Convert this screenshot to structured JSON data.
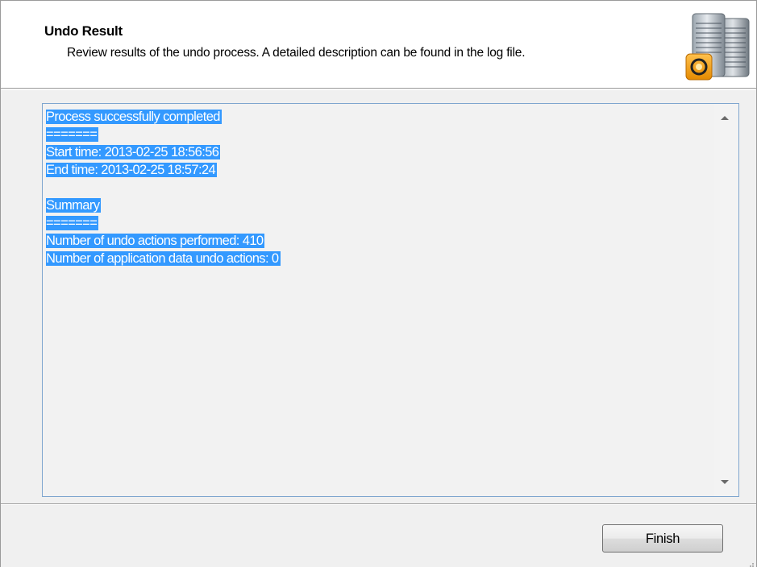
{
  "header": {
    "title": "Undo Result",
    "subtitle": "Review results of the undo process. A detailed description can be found in the log file.",
    "icon": "server-database-icon"
  },
  "log": {
    "lines": [
      "Process successfully completed",
      "=======",
      "Start time: 2013-02-25 18:56:56",
      "End time: 2013-02-25 18:57:24",
      "",
      "Summary",
      "=======",
      "Number of undo actions performed: 410",
      "Number of application data undo actions: 0"
    ],
    "selected": true
  },
  "footer": {
    "finish_label": "Finish"
  },
  "colors": {
    "selection": "#3399ff",
    "selection_text": "#ffffff",
    "log_border": "#7fa6cf",
    "header_bg": "#ffffff",
    "window_bg": "#f0f0f0"
  }
}
